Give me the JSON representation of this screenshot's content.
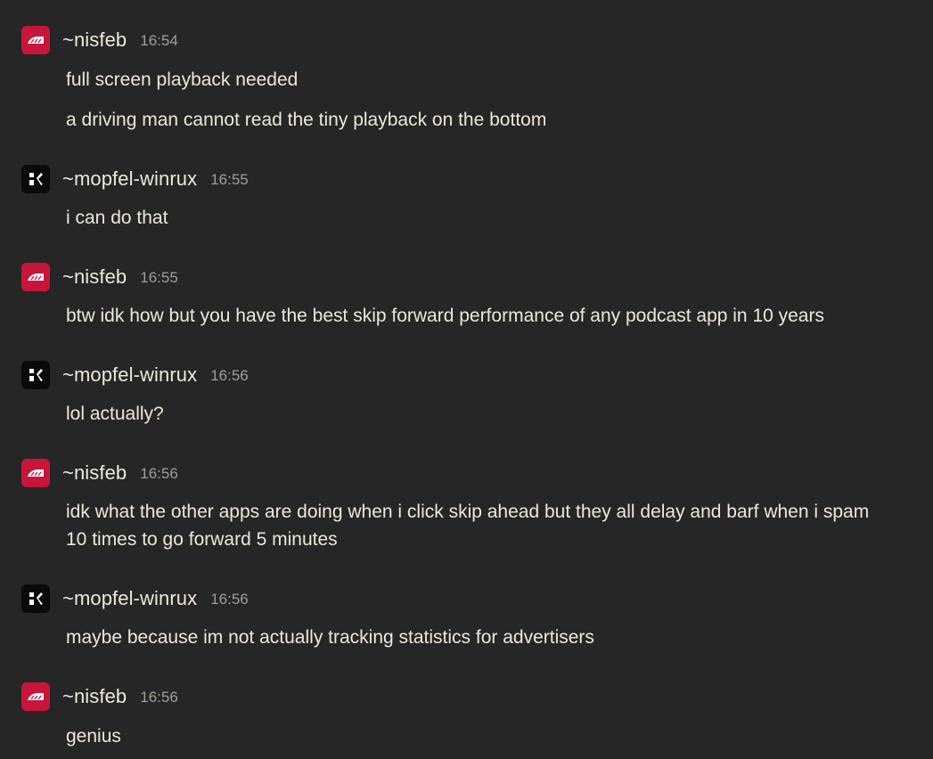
{
  "colors": {
    "background": "#262626",
    "text": "#efe7d8",
    "timestamp": "#a39e94",
    "nisfeb_avatar": "#c8153a",
    "mopfel_avatar": "#0a0a0a"
  },
  "messages": [
    {
      "author": "~nisfeb",
      "time": "16:54",
      "avatar_icon": "red-sigil-icon",
      "lines": [
        "full screen playback needed",
        "a driving man cannot read the tiny playback on the bottom"
      ]
    },
    {
      "author": "~mopfel-winrux",
      "time": "16:55",
      "avatar_icon": "black-sigil-icon",
      "lines": [
        "i can do that"
      ]
    },
    {
      "author": "~nisfeb",
      "time": "16:55",
      "avatar_icon": "red-sigil-icon",
      "lines": [
        "btw idk how but you have the best skip forward performance of any podcast app in 10 years"
      ]
    },
    {
      "author": "~mopfel-winrux",
      "time": "16:56",
      "avatar_icon": "black-sigil-icon",
      "lines": [
        "lol actually?"
      ]
    },
    {
      "author": "~nisfeb",
      "time": "16:56",
      "avatar_icon": "red-sigil-icon",
      "lines": [
        "idk what the other apps are doing when i click skip ahead but they all delay and barf when i spam",
        "10 times to go forward 5 minutes"
      ]
    },
    {
      "author": "~mopfel-winrux",
      "time": "16:56",
      "avatar_icon": "black-sigil-icon",
      "lines": [
        "maybe because im not actually tracking statistics for advertisers"
      ]
    },
    {
      "author": "~nisfeb",
      "time": "16:56",
      "avatar_icon": "red-sigil-icon",
      "lines": [
        "genius"
      ]
    }
  ]
}
